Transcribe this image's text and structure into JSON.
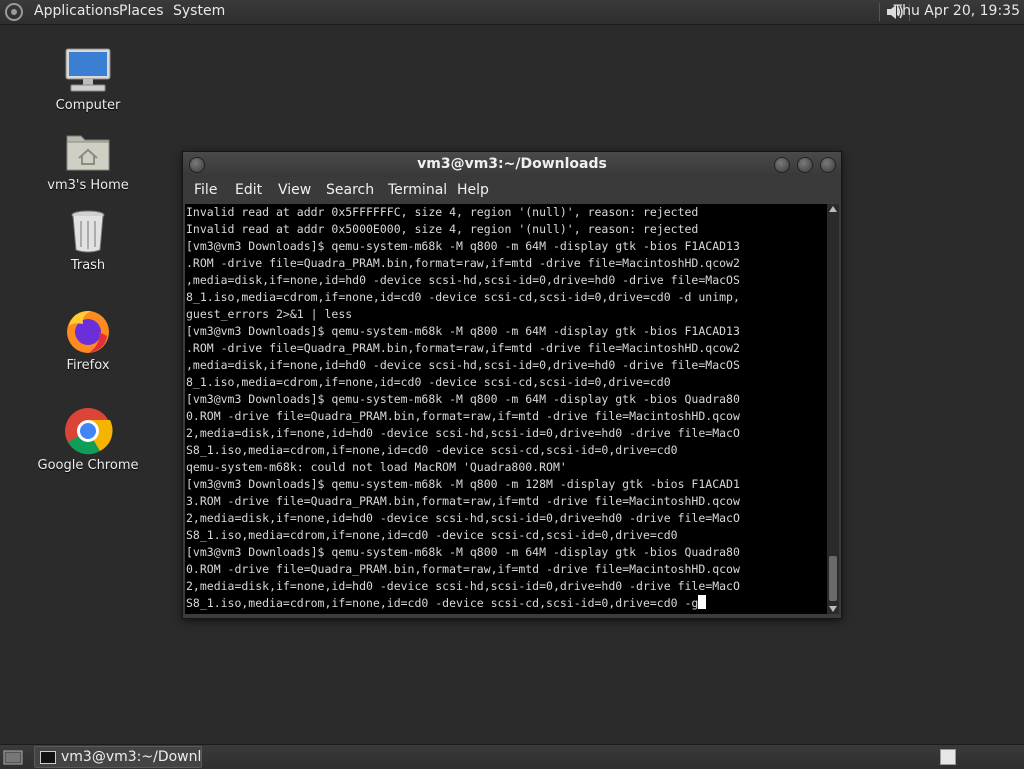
{
  "top_panel": {
    "menus": [
      "Applications",
      "Places",
      "System"
    ],
    "clock": "Thu Apr 20, 19:35",
    "icons": [
      "gnome-foot-icon",
      "volume-icon"
    ]
  },
  "desktop": {
    "icons": [
      {
        "label": "Computer",
        "icon": "computer-icon"
      },
      {
        "label": "vm3's Home",
        "icon": "home-folder-icon"
      },
      {
        "label": "Trash",
        "icon": "trash-icon"
      },
      {
        "label": "Firefox",
        "icon": "firefox-icon"
      },
      {
        "label": "Google Chrome",
        "icon": "chrome-icon"
      }
    ]
  },
  "terminal": {
    "title": "vm3@vm3:~/Downloads",
    "menu": [
      "File",
      "Edit",
      "View",
      "Search",
      "Terminal",
      "Help"
    ],
    "lines": [
      "Invalid read at addr 0x5FFFFFFC, size 4, region '(null)', reason: rejected",
      "Invalid read at addr 0x5000E000, size 4, region '(null)', reason: rejected",
      "[vm3@vm3 Downloads]$ qemu-system-m68k -M q800 -m 64M -display gtk -bios F1ACAD13",
      ".ROM -drive file=Quadra_PRAM.bin,format=raw,if=mtd -drive file=MacintoshHD.qcow2",
      ",media=disk,if=none,id=hd0 -device scsi-hd,scsi-id=0,drive=hd0 -drive file=MacOS",
      "8_1.iso,media=cdrom,if=none,id=cd0 -device scsi-cd,scsi-id=0,drive=cd0 -d unimp,",
      "guest_errors 2>&1 | less",
      "[vm3@vm3 Downloads]$ qemu-system-m68k -M q800 -m 64M -display gtk -bios F1ACAD13",
      ".ROM -drive file=Quadra_PRAM.bin,format=raw,if=mtd -drive file=MacintoshHD.qcow2",
      ",media=disk,if=none,id=hd0 -device scsi-hd,scsi-id=0,drive=hd0 -drive file=MacOS",
      "8_1.iso,media=cdrom,if=none,id=cd0 -device scsi-cd,scsi-id=0,drive=cd0",
      "[vm3@vm3 Downloads]$ qemu-system-m68k -M q800 -m 64M -display gtk -bios Quadra80",
      "0.ROM -drive file=Quadra_PRAM.bin,format=raw,if=mtd -drive file=MacintoshHD.qcow",
      "2,media=disk,if=none,id=hd0 -device scsi-hd,scsi-id=0,drive=hd0 -drive file=MacO",
      "S8_1.iso,media=cdrom,if=none,id=cd0 -device scsi-cd,scsi-id=0,drive=cd0",
      "qemu-system-m68k: could not load MacROM 'Quadra800.ROM'",
      "[vm3@vm3 Downloads]$ qemu-system-m68k -M q800 -m 128M -display gtk -bios F1ACAD1",
      "3.ROM -drive file=Quadra_PRAM.bin,format=raw,if=mtd -drive file=MacintoshHD.qcow",
      "2,media=disk,if=none,id=hd0 -device scsi-hd,scsi-id=0,drive=hd0 -drive file=MacO",
      "S8_1.iso,media=cdrom,if=none,id=cd0 -device scsi-cd,scsi-id=0,drive=cd0",
      "[vm3@vm3 Downloads]$ qemu-system-m68k -M q800 -m 64M -display gtk -bios Quadra80",
      "0.ROM -drive file=Quadra_PRAM.bin,format=raw,if=mtd -drive file=MacintoshHD.qcow",
      "2,media=disk,if=none,id=hd0 -device scsi-hd,scsi-id=0,drive=hd0 -drive file=MacO",
      "S8_1.iso,media=cdrom,if=none,id=cd0 -device scsi-cd,scsi-id=0,drive=cd0 -g"
    ]
  },
  "bottom_panel": {
    "task_label": "vm3@vm3:~/Downl..."
  },
  "colors": {
    "desktop_bg": "#2b2b2b",
    "panel_bg": "#333333",
    "terminal_bg": "#000000",
    "terminal_fg": "#d8d8d8"
  }
}
